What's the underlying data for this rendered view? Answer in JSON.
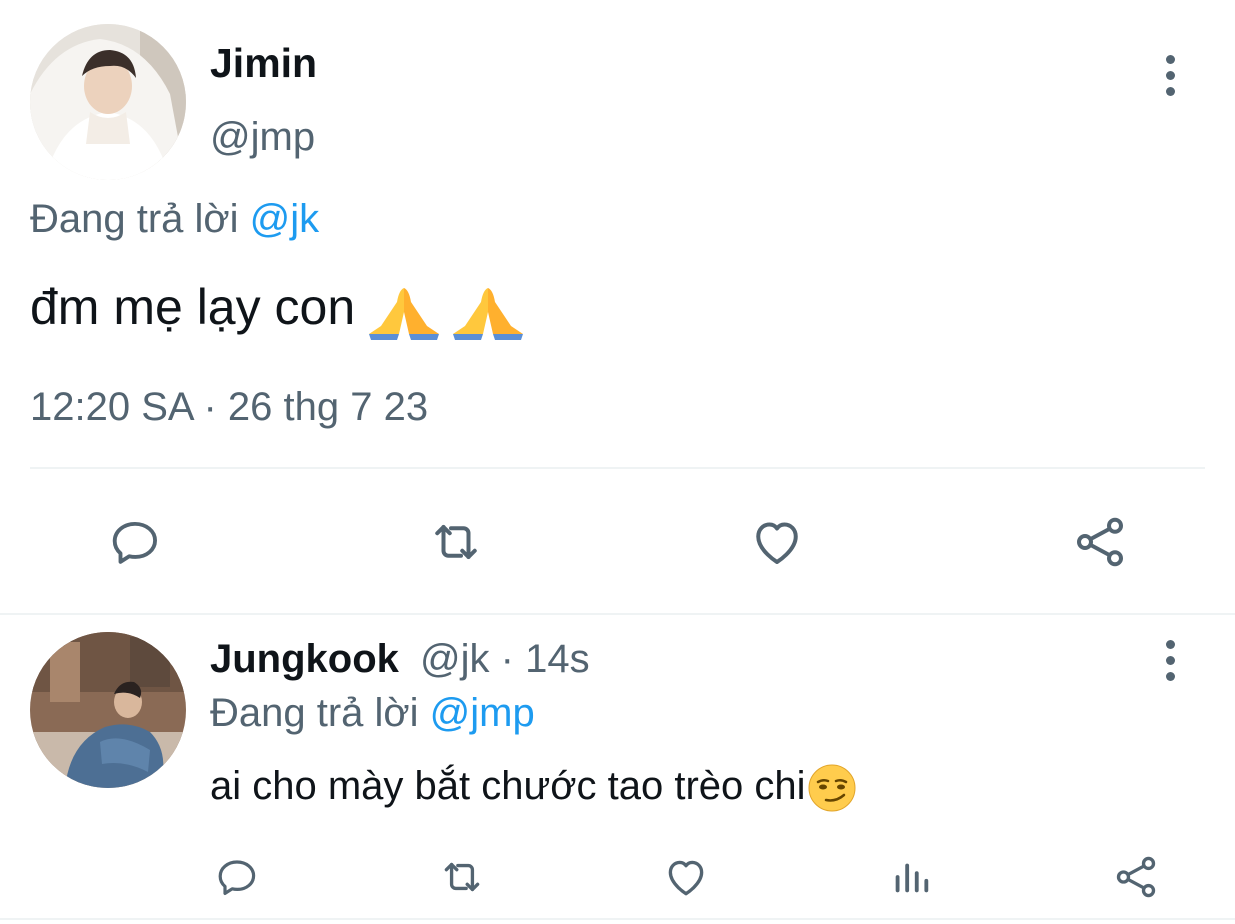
{
  "main_tweet": {
    "author_name": "Jimin",
    "author_handle": "@jmp",
    "replying_prefix": "Đang trả lời",
    "replying_to": "@jk",
    "text": "đm mẹ lạy con",
    "emoji": [
      "folded-hands",
      "folded-hands"
    ],
    "timestamp": "12:20 SA · 26 thg 7 23",
    "actions": [
      "reply-icon",
      "retweet-icon",
      "like-icon",
      "share-icon"
    ]
  },
  "reply_tweet": {
    "author_name": "Jungkook",
    "author_handle": "@jk",
    "time_ago": "· 14s",
    "replying_prefix": "Đang trả lời",
    "replying_to": "@jmp",
    "text": "ai cho mày bắt chước tao trèo chi",
    "emoji": [
      "smirking-face"
    ],
    "actions": [
      "reply-icon",
      "retweet-icon",
      "like-icon",
      "views-icon",
      "share-icon"
    ]
  },
  "colors": {
    "text_primary": "#0f1419",
    "text_secondary": "#536471",
    "accent": "#1d9bf0",
    "divider": "#eff3f4"
  }
}
